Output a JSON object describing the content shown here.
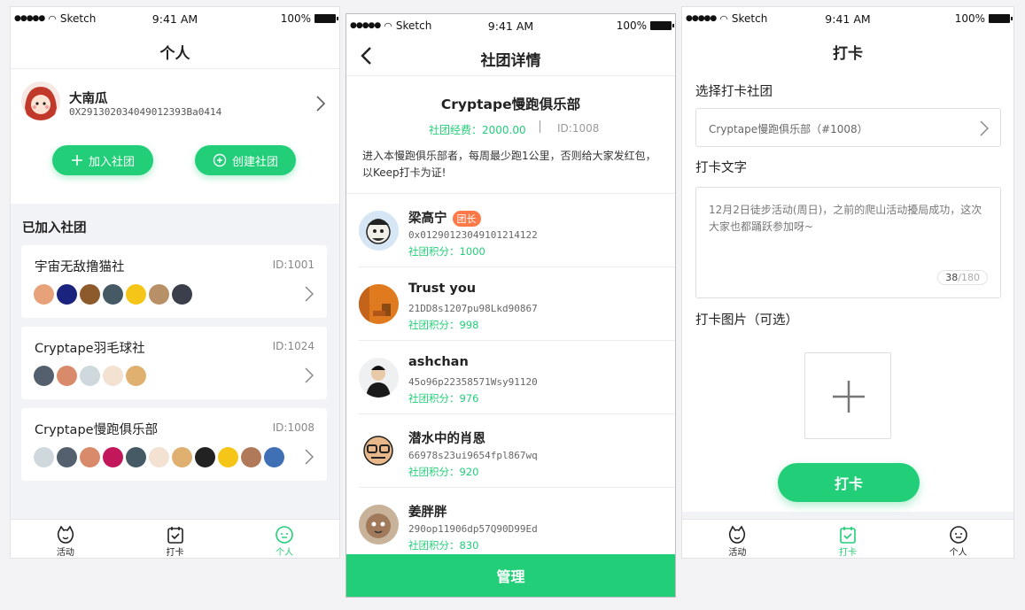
{
  "status_bar": {
    "carrier": "Sketch",
    "time": "9:41 AM",
    "battery": "100%"
  },
  "colors": {
    "accent": "#22cf78",
    "role_badge": "#ff7847"
  },
  "screen1": {
    "title": "个人",
    "profile": {
      "name": "大南瓜",
      "address": "0X291302034049012393Ba0414"
    },
    "buttons": {
      "join": "加入社团",
      "create": "创建社团"
    },
    "section_title": "已加入社团",
    "clubs": [
      {
        "name": "宇宙无敌撸猫社",
        "id": "ID:1001",
        "members": 7
      },
      {
        "name": "Cryptape羽毛球社",
        "id": "ID:1024",
        "members": 5
      },
      {
        "name": "Cryptape慢跑俱乐部",
        "id": "ID:1008",
        "members": 11
      }
    ]
  },
  "screen2": {
    "title": "社团详情",
    "club_name": "Cryptape慢跑俱乐部",
    "fund": "社团经费：2000.00",
    "club_id": "ID:1008",
    "description": "进入本慢跑俱乐部者，每周最少跑1公里，否则给大家发红包，以Keep打卡为证!",
    "members": [
      {
        "name": "梁高宁",
        "role": "团长",
        "address": "0x0129012304910121412​2",
        "score": "社团积分：1000"
      },
      {
        "name": "Trust you",
        "role": "",
        "address": "21DD8s1207pu98Lkd90867",
        "score": "社团积分：998"
      },
      {
        "name": "ashchan",
        "role": "",
        "address": "45o96p22358571Wsy91120",
        "score": "社团积分：976"
      },
      {
        "name": "潜水中的肖恩",
        "role": "",
        "address": "66978s23ui9654fpl867wq",
        "score": "社团积分：920"
      },
      {
        "name": "姜胖胖",
        "role": "",
        "address": "290op11906dp57Q90D99Ed",
        "score": "社团积分：830"
      }
    ],
    "manage_button": "管理"
  },
  "screen3": {
    "title": "打卡",
    "select_label": "选择打卡社团",
    "select_value": "Cryptape慢跑俱乐部（#1008）",
    "text_label": "打卡文字",
    "text_value": "12月2日徒步活动(周日)，之前的爬山活动擾局成功，这次大家也都踊跃参加呀~",
    "counter_current": "38",
    "counter_max": "/180",
    "image_label": "打卡图片（可选）",
    "submit_button": "打卡"
  },
  "tabs": [
    {
      "label": "活动",
      "icon": "activity-icon"
    },
    {
      "label": "打卡",
      "icon": "checkin-icon"
    },
    {
      "label": "个人",
      "icon": "profile-icon"
    }
  ]
}
